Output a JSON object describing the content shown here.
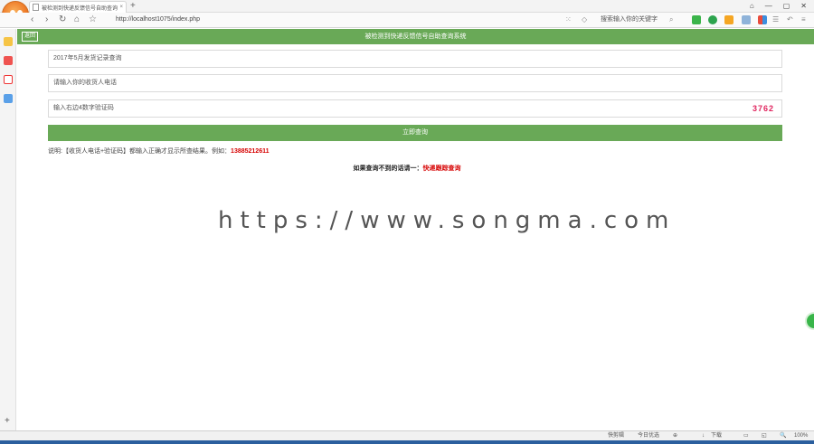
{
  "browser": {
    "tab_title": "被检测到快递反馈信号自助查询系统",
    "tab_close": "×",
    "new_tab": "+",
    "window_buttons": [
      "⌂",
      "—",
      "▢",
      "✕"
    ],
    "nav": {
      "back": "‹",
      "forward": "›",
      "refresh": "↻",
      "home": "⌂",
      "star": "☆"
    },
    "url": "http://localhost1075/index.php",
    "search_placeholder": "搜索输入你的关键字",
    "search_icon": "search-icon",
    "accent": "#69a957"
  },
  "page": {
    "header_back": "返回",
    "header_title": "被检测到快递反馈信号自助查询系统",
    "field_month": "2017年5月发货记录查询",
    "field_phone_placeholder": "请输入你的收货人电话",
    "field_captcha_placeholder": "输入右边4数字验证码",
    "captcha": "3762",
    "submit_label": "立即查询",
    "note_prefix": "说明:【收货人电话+验证码】都输入正确才显示所查结果。例如：",
    "note_phone": "13885212611",
    "hint_prefix": "如果查询不到的话请一：",
    "hint_link": "快递跟踪查询"
  },
  "watermark": "https://www.songma.com",
  "statusbar": {
    "items": [
      "快剪辑",
      "今日优选",
      "⊕",
      "↓",
      "下载",
      "▭",
      "◱",
      "🔍",
      "100%"
    ]
  }
}
